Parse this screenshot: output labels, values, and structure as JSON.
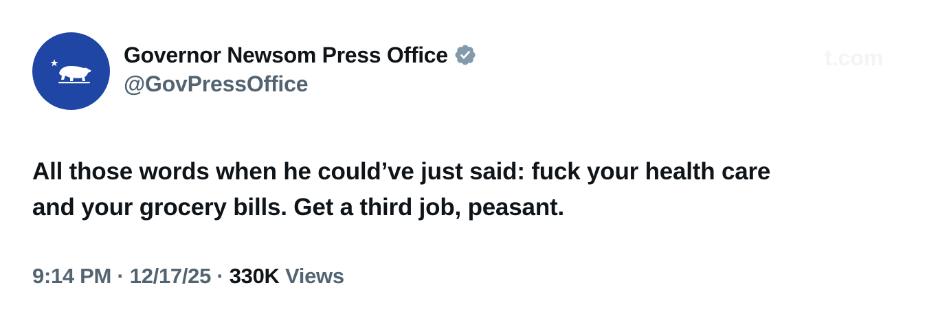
{
  "author": {
    "display_name": "Governor Newsom Press Office",
    "handle": "@GovPressOffice",
    "verified": true,
    "avatar_icon": "california-bear-icon",
    "avatar_color": "#1f46a5",
    "verified_badge_color": "#829aab"
  },
  "tweet": {
    "text_line_1": "All those words when he could’ve just said: fuck your health care",
    "text_line_2": "and your grocery bills. Get a third job, peasant.",
    "time": "9:14 PM",
    "date": "12/17/25",
    "separator": "·",
    "views_count": "330K",
    "views_label": "Views"
  },
  "watermark": {
    "text": "t.com"
  }
}
